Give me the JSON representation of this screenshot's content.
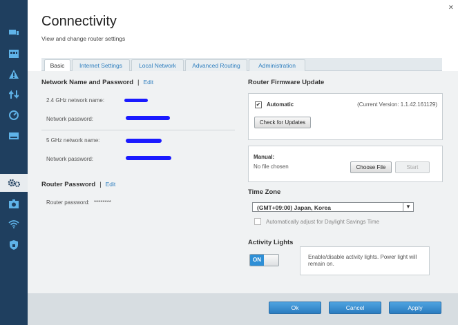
{
  "page": {
    "title": "Connectivity",
    "subtitle": "View and change router settings",
    "close_glyph": "✕"
  },
  "tabs": [
    {
      "label": "Basic",
      "active": true
    },
    {
      "label": "Internet Settings",
      "active": false
    },
    {
      "label": "Local Network",
      "active": false
    },
    {
      "label": "Advanced Routing",
      "active": false
    },
    {
      "label": "Administration",
      "active": false
    }
  ],
  "network_name": {
    "heading": "Network Name and Password",
    "edit": "Edit",
    "separator": "|",
    "fields": [
      {
        "label": "2.4 GHz network name:"
      },
      {
        "label": "Network password:"
      },
      {
        "label": "5 GHz network name:"
      },
      {
        "label": "Network password:"
      }
    ]
  },
  "router_password": {
    "heading": "Router Password",
    "edit": "Edit",
    "separator": "|",
    "label": "Router password:",
    "value": "********"
  },
  "firmware": {
    "heading": "Router Firmware Update",
    "automatic_label": "Automatic",
    "automatic_checked": true,
    "check_mark": "✔",
    "current_version": "(Current Version: 1.1.42.161129)",
    "check_button": "Check for Updates",
    "manual_label": "Manual:",
    "file_status": "No file chosen",
    "choose_file_button": "Choose File",
    "start_button": "Start"
  },
  "time_zone": {
    "heading": "Time Zone",
    "selected": "(GMT+09:00) Japan, Korea",
    "dst_label": "Automatically adjust for Daylight Savings Time",
    "dst_checked": false,
    "arrow": "▼"
  },
  "activity_lights": {
    "heading": "Activity Lights",
    "toggle_state": "ON",
    "description": "Enable/disable activity lights. Power light will remain on."
  },
  "footer": {
    "ok": "Ok",
    "cancel": "Cancel",
    "apply": "Apply"
  },
  "sidebar_icons": [
    "devices-icon",
    "schedule-icon",
    "alert-icon",
    "priority-icon",
    "speed-icon",
    "external-storage-icon",
    "connectivity-gear-icon",
    "troubleshooting-icon",
    "wireless-icon",
    "security-icon"
  ],
  "colors": {
    "accent": "#2f7fbf",
    "sidebar": "#1f3f5f",
    "toggle_on": "#2e8fd6"
  }
}
